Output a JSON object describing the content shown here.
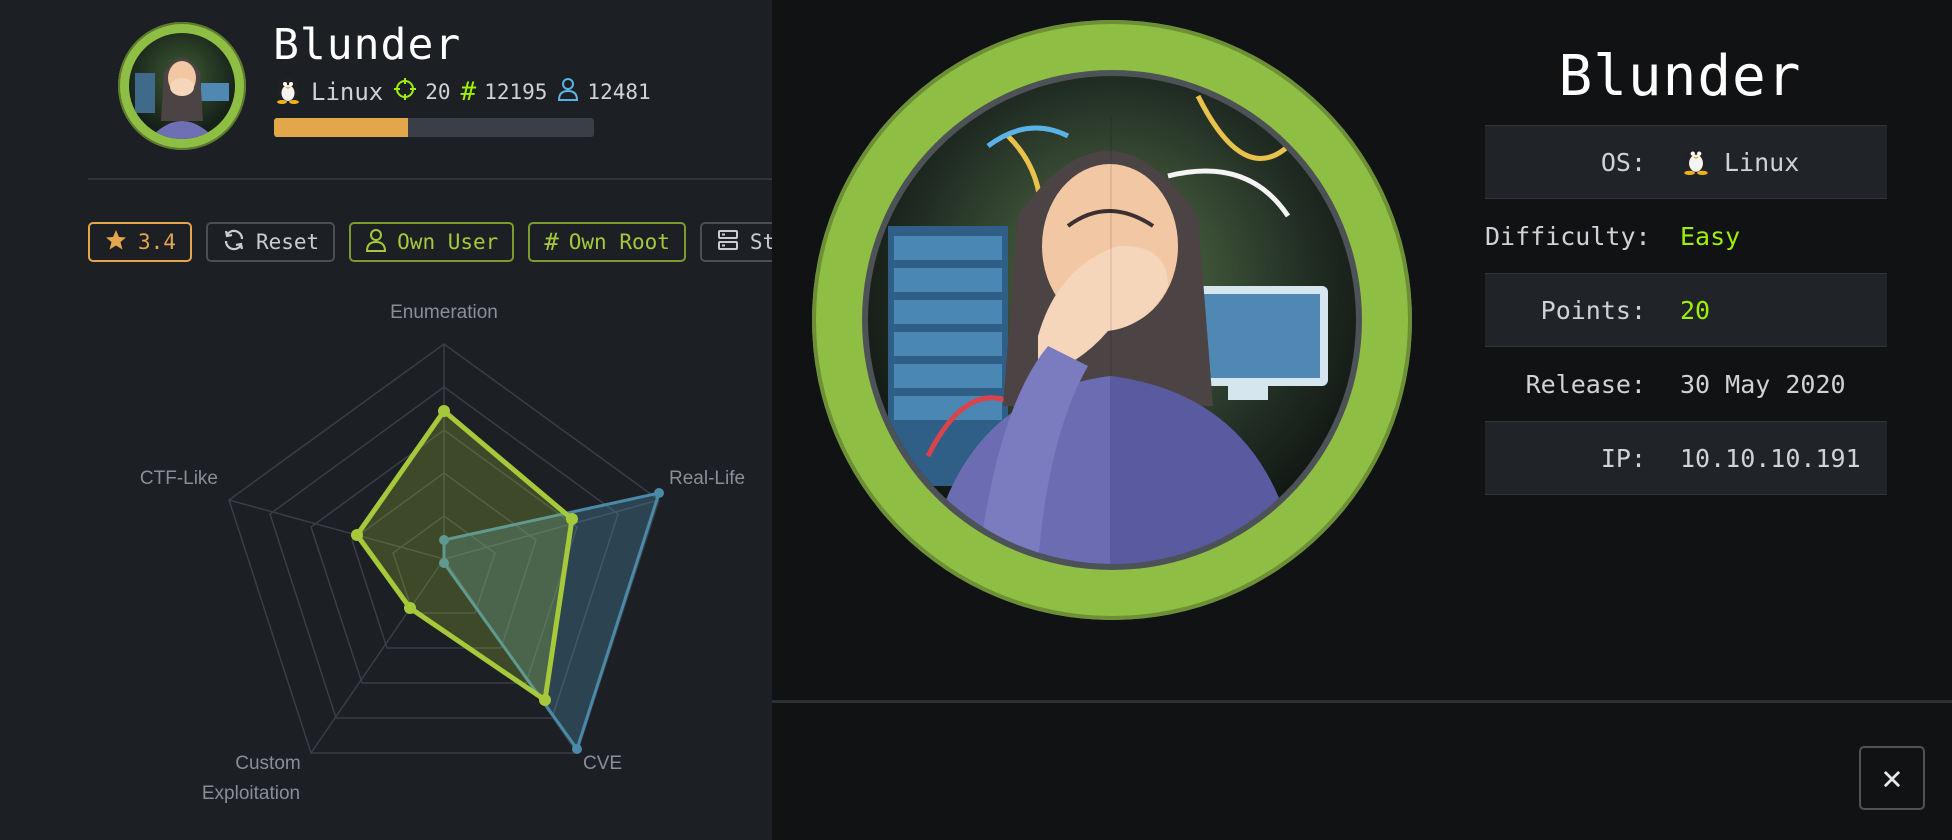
{
  "machine": {
    "name": "Blunder",
    "os": "Linux",
    "points": "20",
    "user_owns": "12195",
    "root_owns": "12481",
    "progress_fraction": 0.42
  },
  "buttons": {
    "rating": "3.4",
    "reset": "Reset",
    "own_user": "Own User",
    "own_root": "Own Root",
    "status": "Status"
  },
  "radar": {
    "labels": {
      "enumeration": "Enumeration",
      "real_life": "Real-Life",
      "cve": "CVE",
      "custom_1": "Custom",
      "custom_2": "Exploitation",
      "ctf_like": "CTF-Like"
    }
  },
  "info": {
    "title": "Blunder",
    "rows": [
      {
        "key": "OS:",
        "value": "Linux"
      },
      {
        "key": "Difficulty:",
        "value": "Easy"
      },
      {
        "key": "Points:",
        "value": "20"
      },
      {
        "key": "Release:",
        "value": "30 May 2020"
      },
      {
        "key": "IP:",
        "value": "10.10.10.191"
      }
    ]
  },
  "close": "✕",
  "colors": {
    "accent_green": "#9fef00",
    "rating_orange": "#e4a64b",
    "radar_green": "#a5c93a",
    "radar_blue": "#4a8aa8"
  }
}
